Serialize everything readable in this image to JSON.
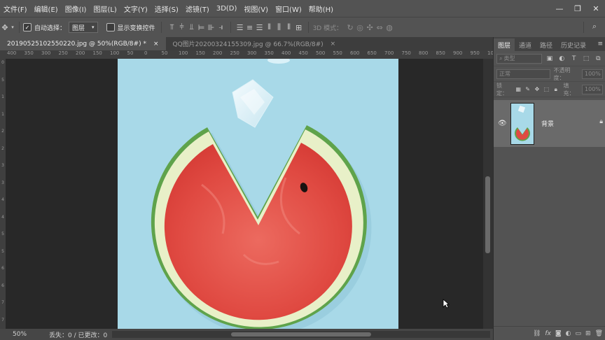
{
  "menubar": {
    "items": [
      "文件(F)",
      "编辑(E)",
      "图像(I)",
      "图层(L)",
      "文字(Y)",
      "选择(S)",
      "滤镜(T)",
      "3D(D)",
      "视图(V)",
      "窗口(W)",
      "帮助(H)"
    ]
  },
  "options": {
    "auto_select_label": "自动选择：",
    "auto_select_value": "图层",
    "show_transform_label": "显示变换控件",
    "mode_3d_label": "3D 模式："
  },
  "tabs": [
    {
      "label": "20190525102550220.jpg @ 50%(RGB/8#) *",
      "close": "×"
    },
    {
      "label": "QQ图片20200324155309.jpg @ 66.7%(RGB/8#)",
      "close": "×"
    }
  ],
  "ruler": {
    "h_labels": [
      "400",
      "350",
      "300",
      "250",
      "200",
      "150",
      "100",
      "50",
      "0",
      "50",
      "100",
      "150",
      "200",
      "250",
      "300",
      "350",
      "400",
      "450",
      "500",
      "550",
      "600",
      "650",
      "700",
      "750",
      "800",
      "850",
      "900",
      "950",
      "1000",
      "1050",
      "1100",
      "1150"
    ],
    "v_labels": [
      "0",
      "50",
      "100",
      "150",
      "200",
      "250",
      "300",
      "350",
      "400",
      "450",
      "500",
      "550",
      "600",
      "650",
      "700",
      "750"
    ]
  },
  "status": {
    "zoom": "50%",
    "info": "丢失：0 / 已更改：0"
  },
  "layers_panel": {
    "tabs": [
      "图层",
      "通道",
      "路径",
      "历史记录"
    ],
    "filter_placeholder": "类型",
    "blend_mode": "正常",
    "opacity_label": "不透明度：",
    "opacity_value": "100%",
    "lock_label": "锁定：",
    "fill_label": "填充：",
    "fill_value": "100%",
    "layer_name": "背景",
    "footer_icons": [
      "link-icon",
      "fx-icon",
      "mask-icon",
      "adjustment-icon",
      "folder-icon",
      "new-layer-icon",
      "trash-icon"
    ],
    "footer_fx": "fx"
  },
  "colors": {
    "background_blue": "#a8d9e8",
    "rind_green": "#5fa34b",
    "flesh_red": "#e0473f"
  }
}
